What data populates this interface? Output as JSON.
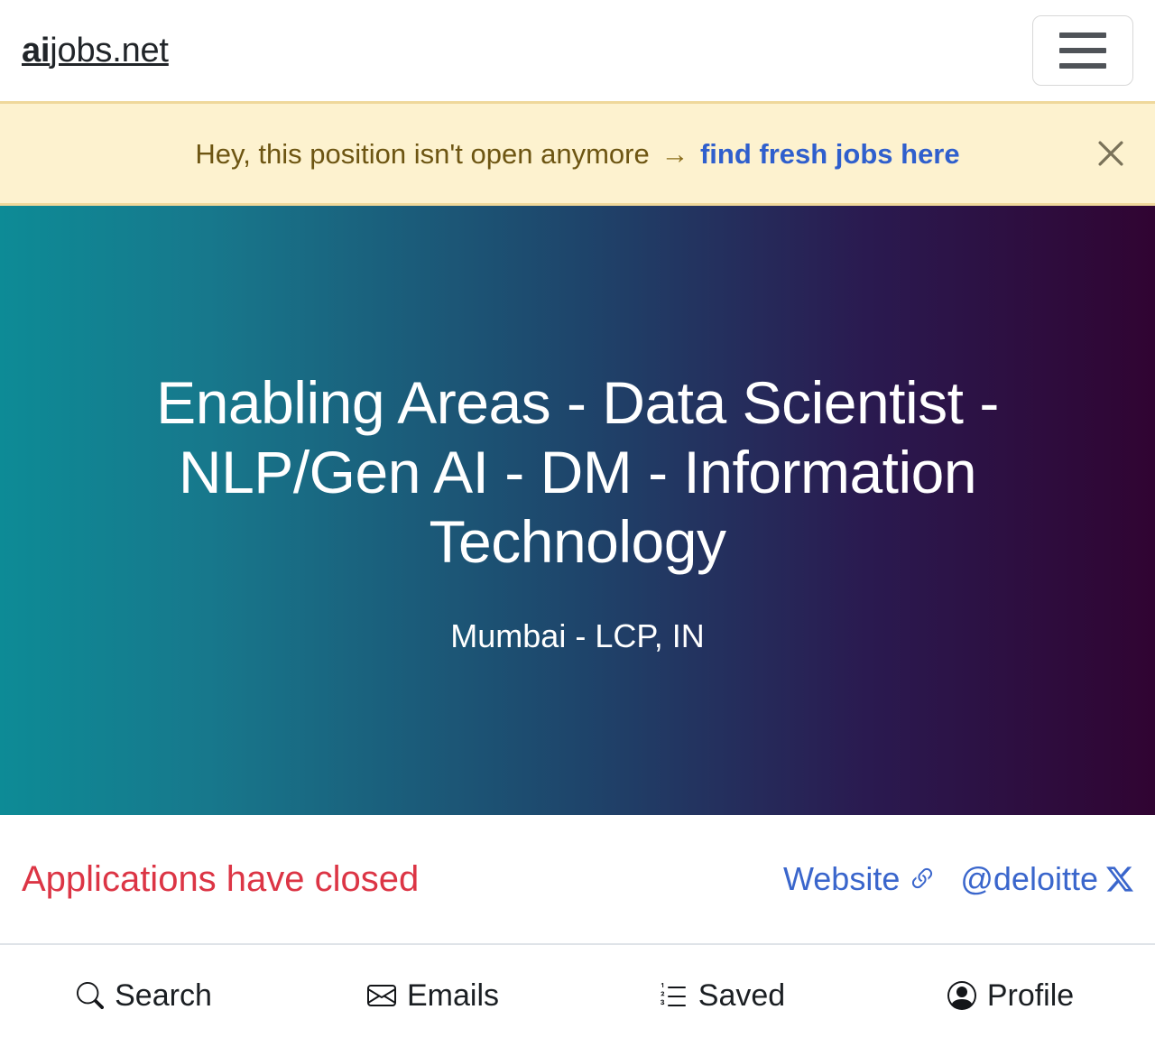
{
  "header": {
    "brand_ai": "ai",
    "brand_rest": "jobs.net",
    "menu_icon": "hamburger-menu-icon"
  },
  "alert": {
    "message": "Hey, this position isn't open anymore",
    "arrow": "→",
    "link_label": "find fresh jobs here",
    "close_icon": "close-icon",
    "background_color": "#fdf2cf",
    "border_color": "#efd89b",
    "text_color": "#6d5512",
    "link_color": "#2f5fcd"
  },
  "hero": {
    "title": "Enabling Areas - Data Scientist - NLP/Gen AI - DM - Information Technology",
    "location": "Mumbai - LCP, IN",
    "gradient_start": "#0d8b96",
    "gradient_mid": "#1e456b",
    "gradient_end": "#300432"
  },
  "status": {
    "closed_label": "Applications have closed",
    "closed_color": "#dc3545",
    "links": [
      {
        "label": "Website",
        "icon": "link-chain-icon"
      },
      {
        "label": "@deloitte",
        "icon": "x-twitter-icon"
      }
    ],
    "link_color": "#3a66cc"
  },
  "bottom_nav": {
    "items": [
      {
        "label": "Search",
        "icon": "search-icon"
      },
      {
        "label": "Emails",
        "icon": "envelope-icon"
      },
      {
        "label": "Saved",
        "icon": "ordered-list-icon"
      },
      {
        "label": "Profile",
        "icon": "person-circle-icon"
      }
    ]
  }
}
